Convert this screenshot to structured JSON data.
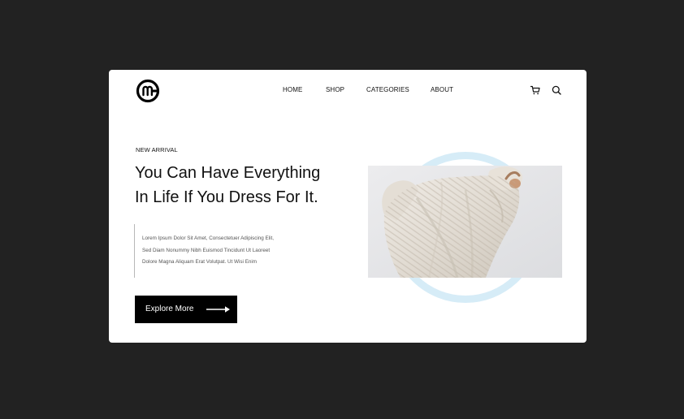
{
  "nav": {
    "items": [
      {
        "label": "HOME"
      },
      {
        "label": "SHOP"
      },
      {
        "label": "CATEGORIES"
      },
      {
        "label": "ABOUT"
      }
    ]
  },
  "icons": {
    "logo": "brand-logo-icon",
    "cart": "cart-icon",
    "search": "search-icon",
    "arrow": "arrow-right-icon"
  },
  "hero": {
    "eyebrow": "NEW ARRIVAL",
    "headline_line1": "You Can Have Everything",
    "headline_line2": "In Life If You Dress For It.",
    "body_line1": "Lorem Ipsum Dolor Sit Amet, Consectetuer Adipiscing Elit,",
    "body_line2": "Sed Diam Nonummy Nibh Euismod Tincidunt Ut Laoreet",
    "body_line3": "Dolore Magna Aliquam Erat Volutpat. Ut Wisi Enim",
    "cta_label": "Explore More"
  },
  "colors": {
    "background": "#222222",
    "card": "#ffffff",
    "accent_ring": "#d6ecf7",
    "button": "#000000"
  }
}
